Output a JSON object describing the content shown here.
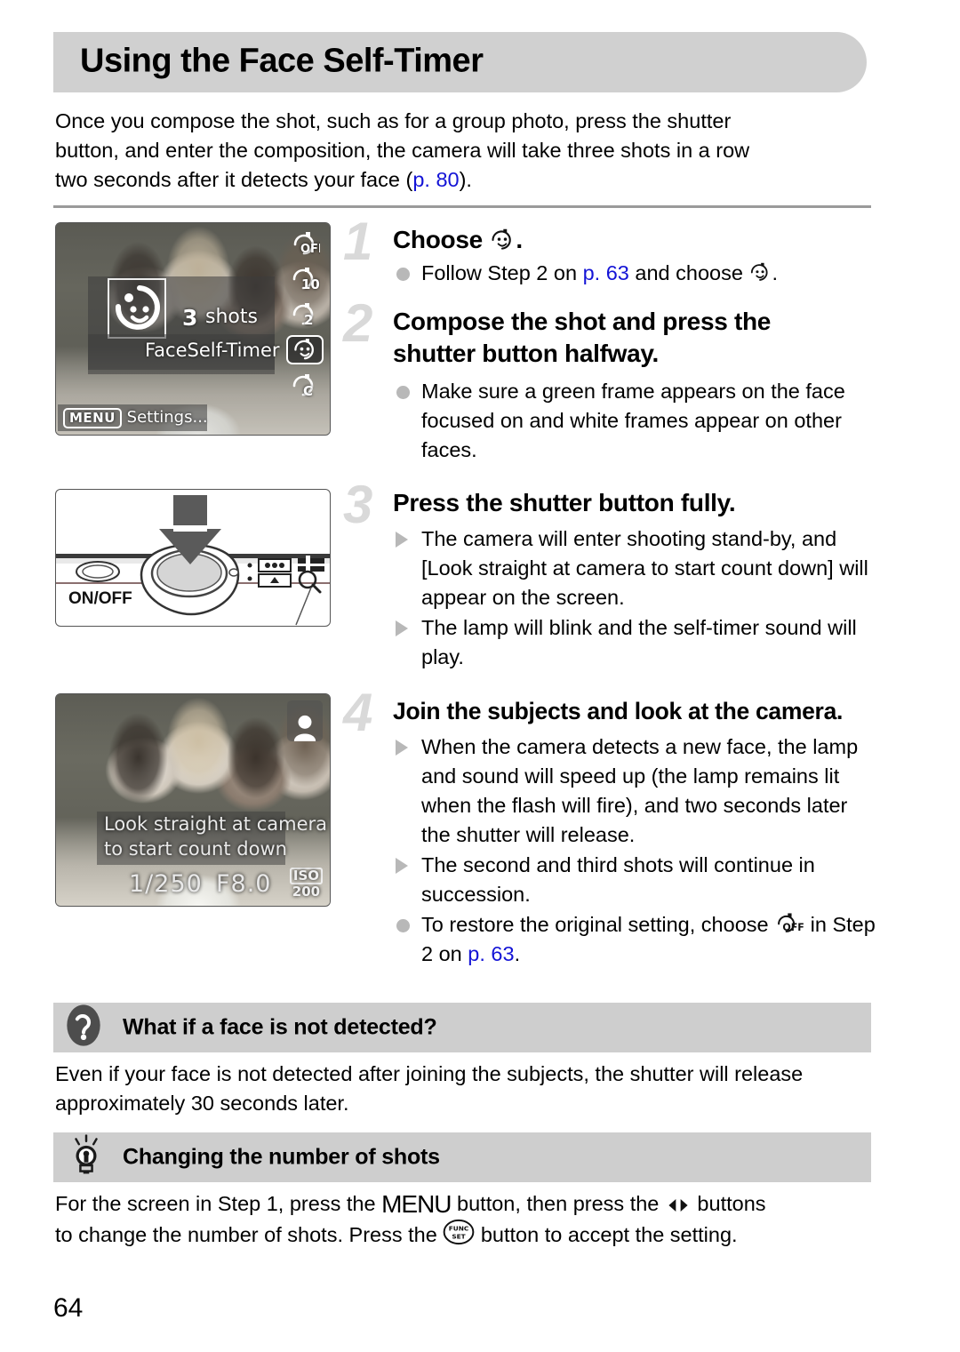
{
  "page": {
    "title": "Using the Face Self-Timer",
    "number": "64"
  },
  "intro": {
    "line1": "Once you compose the shot, such as for a group photo, press the shutter",
    "line2": "button, and enter the composition, the camera will take three shots in a row",
    "line3_pre": "two seconds after it detects your face (",
    "line3_ref": "p. 80",
    "line3_post": ")."
  },
  "figures": {
    "lcd_menu": {
      "name": "self-timer-menu-screen",
      "mode_label": "FaceSelf-Timer",
      "shots_count": "3",
      "shots_word": "shots",
      "menu_badge": "MENU",
      "menu_action": "Settings...",
      "timer_options": [
        {
          "id": "timer-off",
          "label": "OFF",
          "selected": false
        },
        {
          "id": "timer-10s",
          "label": "10",
          "selected": false
        },
        {
          "id": "timer-2s",
          "label": "2",
          "selected": false
        },
        {
          "id": "timer-face",
          "label": "",
          "selected": true
        },
        {
          "id": "timer-custom",
          "label": "C",
          "selected": false
        }
      ]
    },
    "camera_top": {
      "name": "camera-top-view",
      "onoff_label": "ON/OFF"
    },
    "lcd_shoot": {
      "name": "shooting-standby-screen",
      "osd_line1": "Look straight at camera",
      "osd_line2": "to start count down",
      "shutter_speed": "1/250",
      "aperture": "F8.0",
      "iso_word": "ISO",
      "iso_value": "200"
    }
  },
  "steps": [
    {
      "num": "1",
      "head_pre": "Choose ",
      "head_post": ".",
      "bullets": [
        {
          "marker": "dot",
          "pre": "Follow Step 2 on ",
          "ref": "p. 63",
          "mid": " and choose ",
          "post": "."
        }
      ]
    },
    {
      "num": "2",
      "head_line1": "Compose the shot and press the",
      "head_line2": "shutter button halfway.",
      "bullets": [
        {
          "marker": "dot",
          "text": "Make sure a green frame appears on the face focused on and white frames appear on other faces."
        }
      ]
    },
    {
      "num": "3",
      "head_line1": "Press the shutter button fully.",
      "bullets": [
        {
          "marker": "tri",
          "text": "The camera will enter shooting stand-by, and [Look straight at camera to start count down] will appear on the screen."
        },
        {
          "marker": "tri",
          "text": "The lamp will blink and the self-timer sound will play."
        }
      ]
    },
    {
      "num": "4",
      "head_line1": "Join the subjects and look at the camera.",
      "bullets": [
        {
          "marker": "tri",
          "text": "When the camera detects a new face, the lamp and sound will speed up (the lamp remains lit when the flash will fire), and two seconds later the shutter will release."
        },
        {
          "marker": "tri",
          "text": "The second and third shots will continue in succession."
        },
        {
          "marker": "dot",
          "pre": "To restore the original setting, choose ",
          "mid": " in Step 2 on ",
          "ref": "p. 63",
          "post": "."
        }
      ]
    }
  ],
  "callouts": [
    {
      "icon": "question-mark-icon",
      "title": "What if a face is not detected?",
      "body_line1": "Even if your face is not detected after joining the subjects, the shutter will release",
      "body_line2": "approximately 30 seconds later."
    },
    {
      "icon": "lightbulb-icon",
      "title": "Changing the number of shots",
      "body_pre": "For the screen in Step 1, press the ",
      "body_menu": "MENU",
      "body_mid1": " button, then press the ",
      "body_mid2": " buttons",
      "body_line2_pre": "to change the number of shots. Press the ",
      "body_line2_post": " button to accept the setting."
    }
  ],
  "colors": {
    "accent_link": "#1414d6",
    "bar_gray": "#cecece",
    "step_num_gray": "#d9d9d9"
  }
}
